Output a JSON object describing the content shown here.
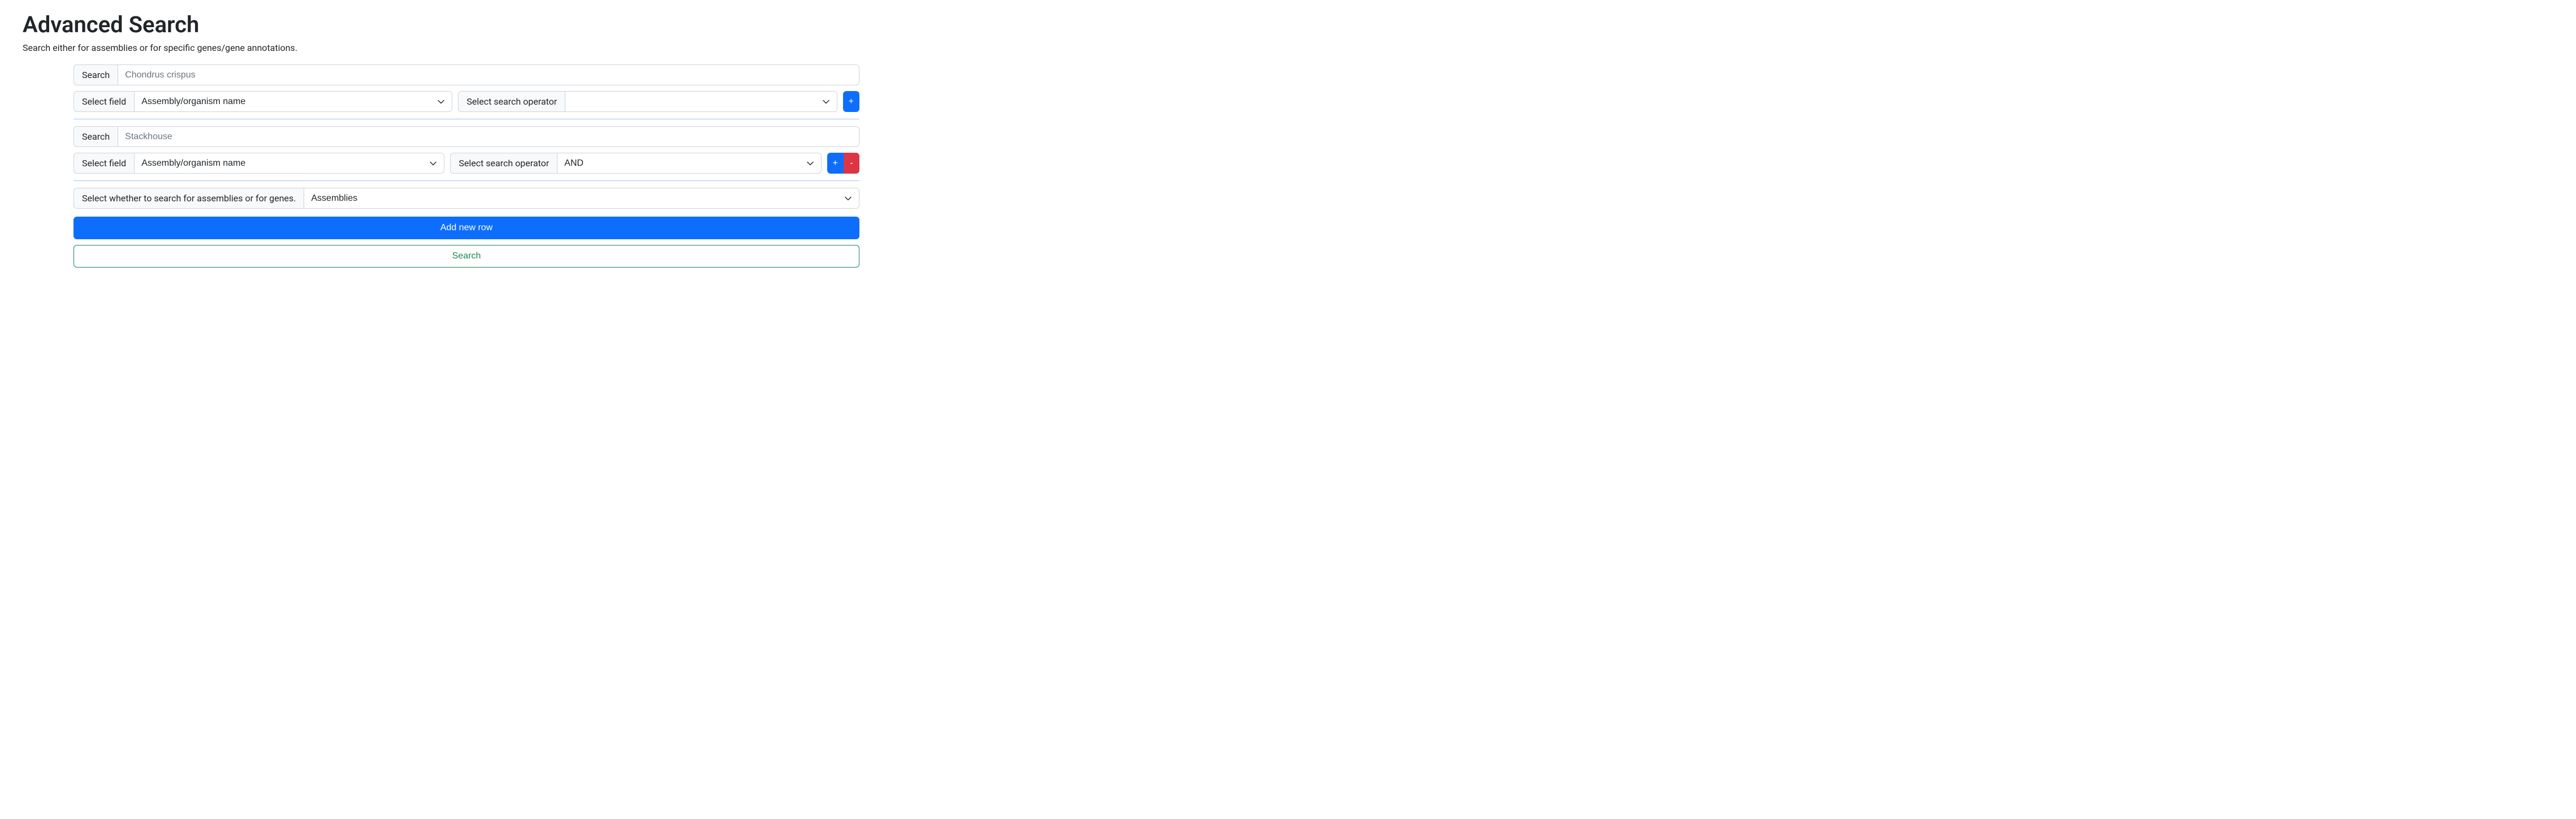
{
  "title": "Advanced Search",
  "subtitle": "Search either for assemblies or for specific genes/gene annotations.",
  "labels": {
    "search": "Search",
    "select_field": "Select field",
    "select_operator": "Select search operator",
    "select_type": "Select whether to search for assemblies or for genes."
  },
  "rows": [
    {
      "placeholder": "Chondrus crispus",
      "value": "",
      "field": "Assembly/organism name",
      "operator": "",
      "show_remove": false
    },
    {
      "placeholder": "Stackhouse",
      "value": "",
      "field": "Assembly/organism name",
      "operator": "AND",
      "show_remove": true
    }
  ],
  "search_type": "Assemblies",
  "buttons": {
    "add_row": "Add new row",
    "search": "Search",
    "plus": "+",
    "minus": "-"
  }
}
